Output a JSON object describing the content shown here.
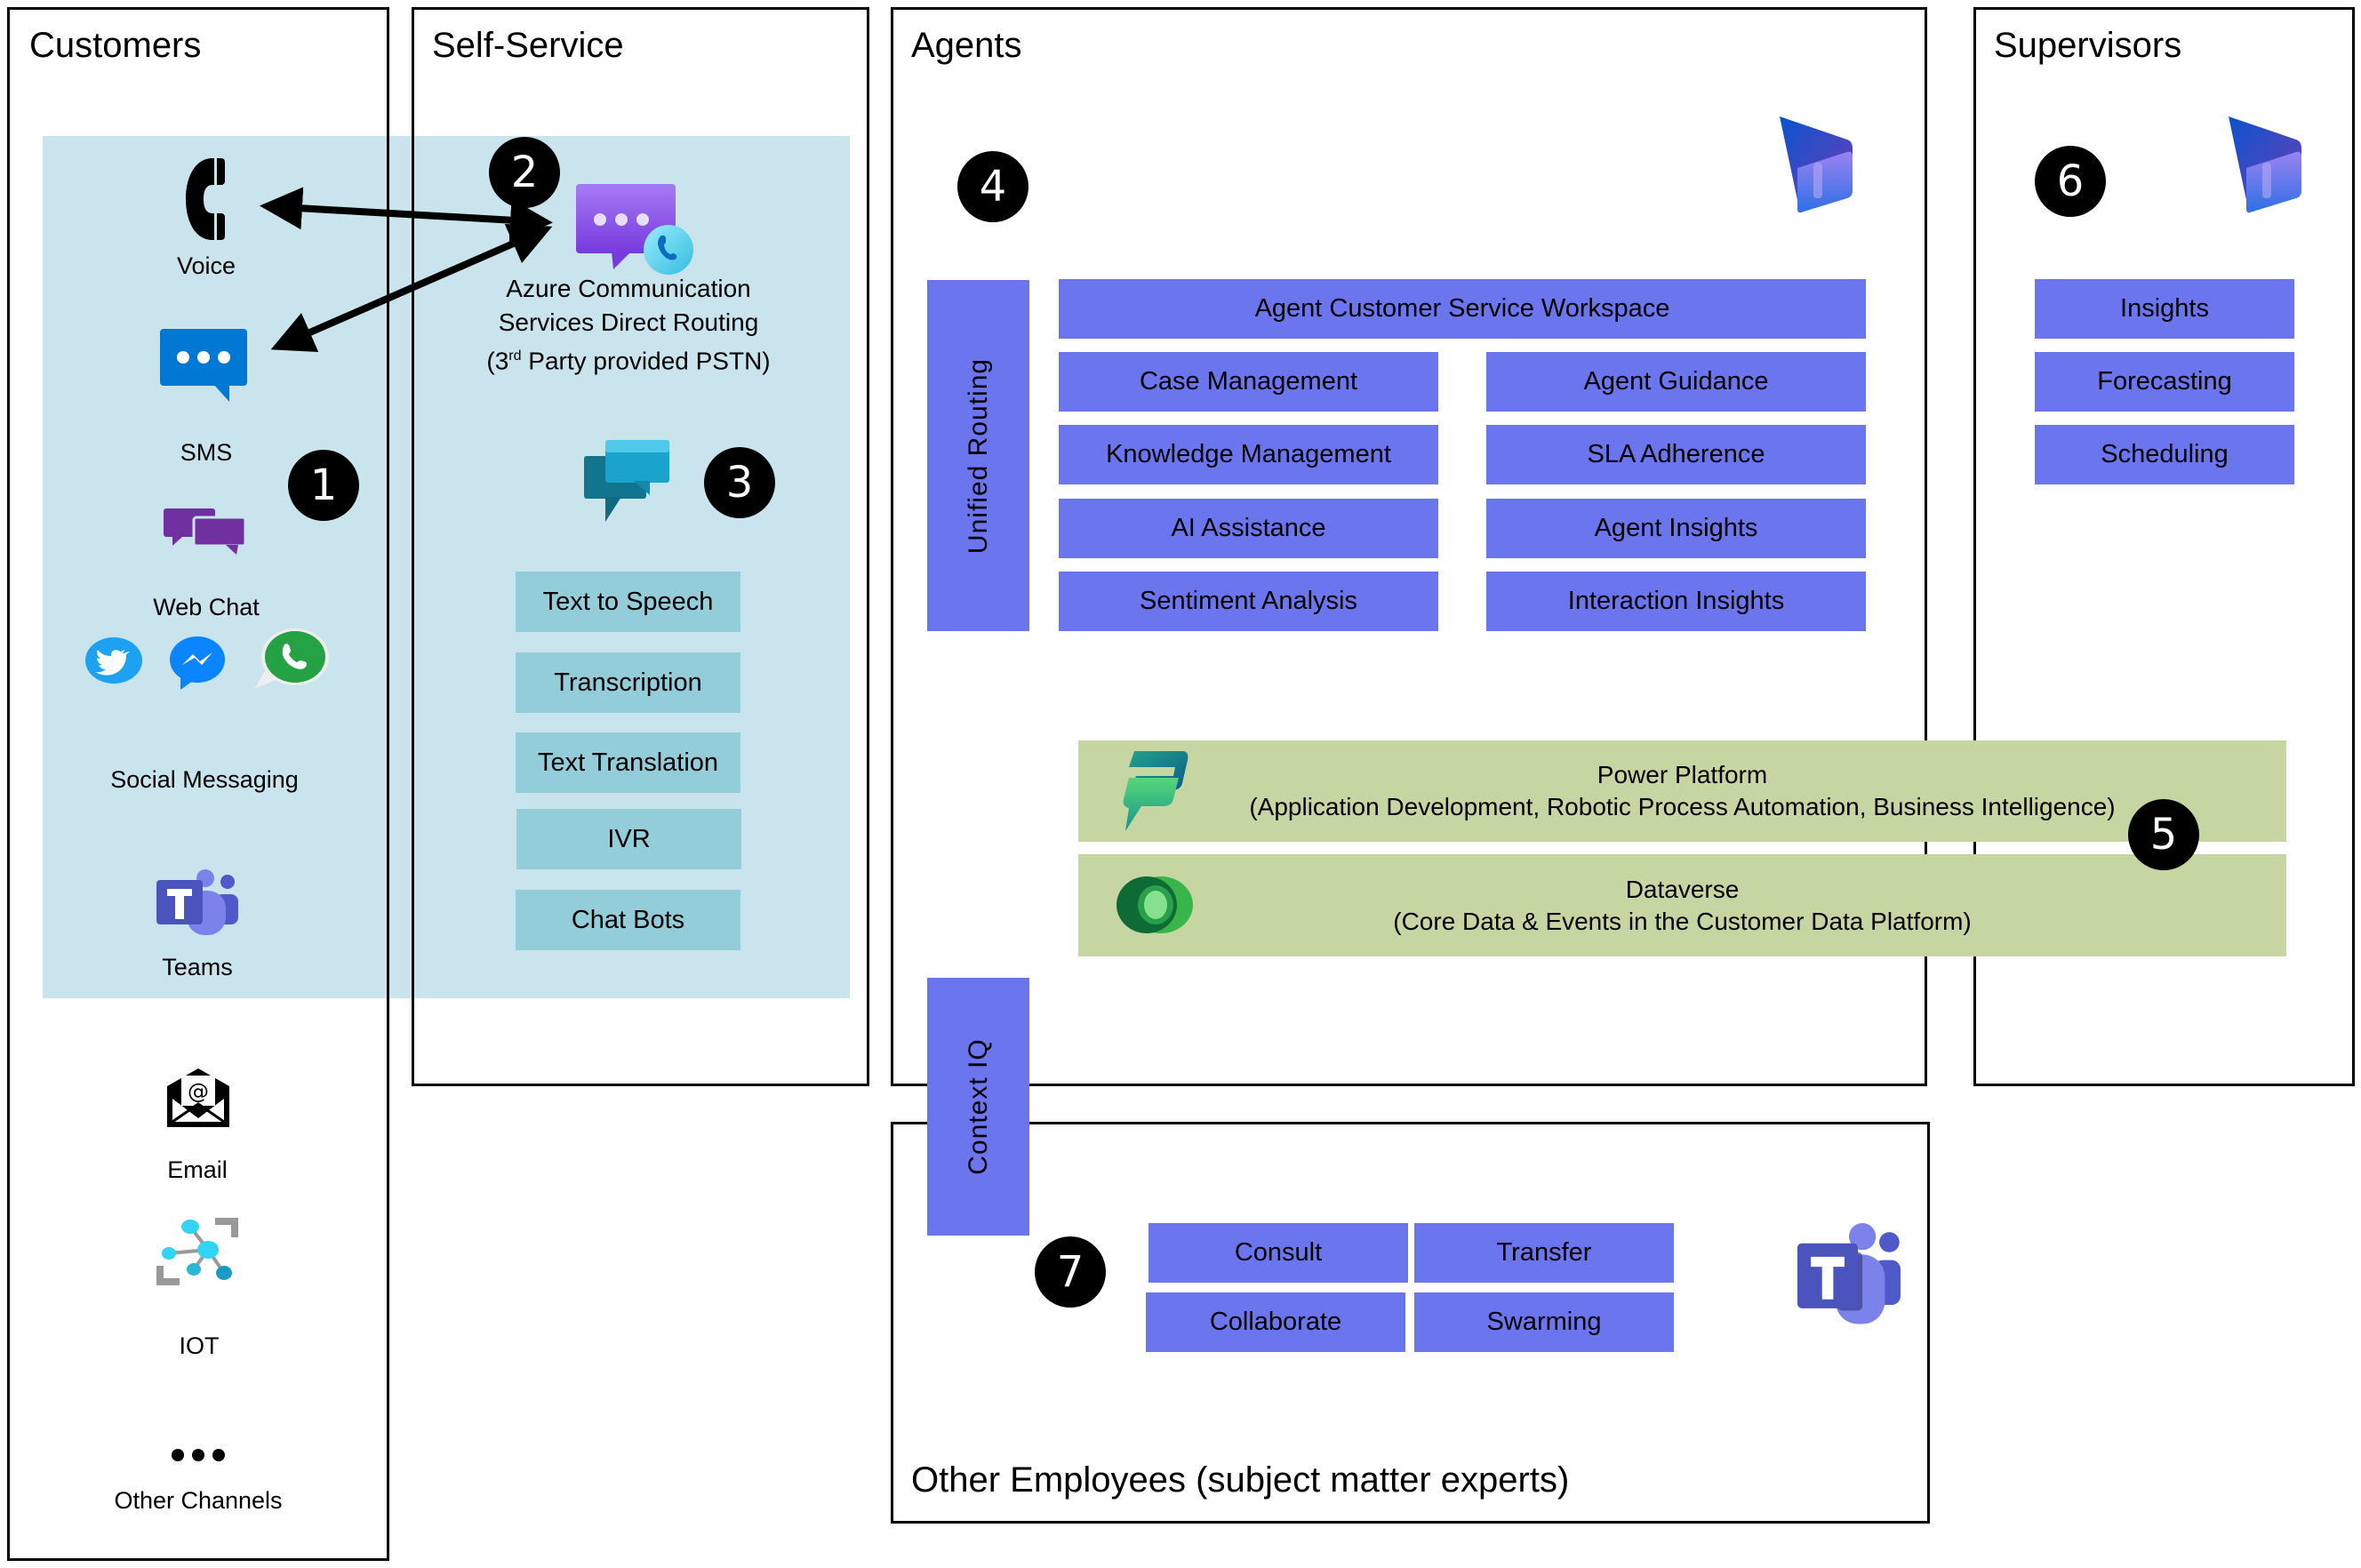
{
  "panels": {
    "customers": "Customers",
    "self_service": "Self-Service",
    "agents": "Agents",
    "supervisors": "Supervisors",
    "other_employees": "Other Employees (subject matter experts)"
  },
  "customer_channels": {
    "voice": "Voice",
    "sms": "SMS",
    "web_chat": "Web Chat",
    "social_messaging": "Social Messaging",
    "teams": "Teams",
    "email": "Email",
    "iot": "IOT",
    "other_channels": "Other Channels"
  },
  "acs": {
    "line1": "Azure Communication",
    "line2": "Services Direct Routing",
    "line3_prefix": "(3",
    "line3_sup": "rd",
    "line3_suffix": " Party provided PSTN)"
  },
  "self_service_items": [
    "Text to Speech",
    "Transcription",
    "Text Translation",
    "IVR",
    "Chat Bots"
  ],
  "agents": {
    "unified_routing": "Unified Routing",
    "workspace": "Agent Customer Service Workspace",
    "left_column": [
      "Case Management",
      "Knowledge Management",
      "AI Assistance",
      "Sentiment Analysis"
    ],
    "right_column": [
      "Agent Guidance",
      "SLA Adherence",
      "Agent Insights",
      "Interaction Insights"
    ],
    "context_iq": "Context IQ"
  },
  "platform": {
    "power_platform_title": "Power Platform",
    "power_platform_subtitle": "(Application Development, Robotic Process Automation, Business Intelligence)",
    "dataverse_title": "Dataverse",
    "dataverse_subtitle": "(Core Data & Events in the Customer Data Platform)"
  },
  "supervisor_items": [
    "Insights",
    "Forecasting",
    "Scheduling"
  ],
  "collaboration_items": [
    "Consult",
    "Transfer",
    "Collaborate",
    "Swarming"
  ],
  "badges": [
    "1",
    "2",
    "3",
    "4",
    "5",
    "6",
    "7"
  ],
  "colors": {
    "agent_tile": "#6b75ee",
    "self_service_tile": "#93cdda",
    "channel_band": "#c9e4ec",
    "platform_band": "#c5d6a2"
  }
}
